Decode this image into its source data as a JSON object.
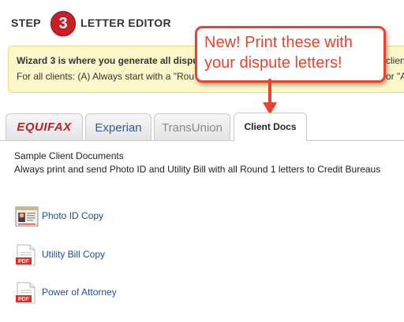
{
  "header": {
    "step_label": "STEP",
    "step_number": "3",
    "title": "LETTER EDITOR",
    "accent_color": "#c62026"
  },
  "notice": {
    "line1": "Wizard 3 is where you generate all dispu",
    "line2": "For all clients: (A) Always start with a \"Rou",
    "line1_right": "clien",
    "line2_right": "or \"A",
    "background_color": "#fdf8c9"
  },
  "callout": {
    "line1": "New! Print these with",
    "line2": "your dispute letters!",
    "color": "#e8432e"
  },
  "tabs": [
    {
      "label": "EQUIFAX",
      "active": false
    },
    {
      "label": "Experian",
      "active": false
    },
    {
      "label": "TransUnion",
      "active": false
    },
    {
      "label": "Client Docs",
      "active": true
    }
  ],
  "content": {
    "title": "Sample Client Documents",
    "description": "Always print and send Photo ID and Utility Bill with all Round 1 letters to Credit Bureaus",
    "documents": [
      {
        "label": "Photo ID Copy",
        "icon": "photo-id-card-icon"
      },
      {
        "label": "Utility Bill Copy",
        "icon": "pdf-file-icon"
      },
      {
        "label": "Power of Attorney",
        "icon": "pdf-file-icon"
      }
    ],
    "link_color": "#1f4e96"
  }
}
